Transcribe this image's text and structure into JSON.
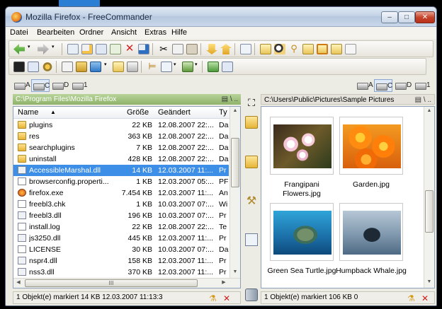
{
  "window": {
    "title": "Mozilla Firefox - FreeCommander",
    "min_label": "–",
    "max_label": "□",
    "close_label": "✕"
  },
  "menu": [
    "Datei",
    "Bearbeiten",
    "Ordner",
    "Ansicht",
    "Extras",
    "Hilfe"
  ],
  "drives": [
    "A",
    "C",
    "D",
    "1"
  ],
  "left_panel": {
    "path": "C:\\Program Files\\Mozilla Firefox",
    "path_tools": "▤ \\ ..",
    "columns": {
      "name": "Name",
      "sort_arrow": "▲",
      "size": "Größe",
      "date": "Geändert",
      "type": "Ty"
    },
    "rows": [
      {
        "icon": "folder",
        "name": "plugins",
        "size": "22 KB",
        "date": "12.08.2007 22:...",
        "type": "Da",
        "selected": false
      },
      {
        "icon": "folder",
        "name": "res",
        "size": "363 KB",
        "date": "12.08.2007 22:...",
        "type": "Da",
        "selected": false
      },
      {
        "icon": "folder",
        "name": "searchplugins",
        "size": "7 KB",
        "date": "12.08.2007 22:...",
        "type": "Da",
        "selected": false
      },
      {
        "icon": "folder",
        "name": "uninstall",
        "size": "428 KB",
        "date": "12.08.2007 22:...",
        "type": "Da",
        "selected": false
      },
      {
        "icon": "dll",
        "name": "AccessibleMarshal.dll",
        "size": "14 KB",
        "date": "12.03.2007 11:...",
        "type": "Pr",
        "selected": true
      },
      {
        "icon": "file",
        "name": "browserconfig.properti...",
        "size": "1 KB",
        "date": "12.03.2007 05:...",
        "type": "PF",
        "selected": false
      },
      {
        "icon": "exe",
        "name": "firefox.exe",
        "size": "7.454 KB",
        "date": "12.03.2007 11:...",
        "type": "An",
        "selected": false
      },
      {
        "icon": "file",
        "name": "freebl3.chk",
        "size": "1 KB",
        "date": "10.03.2007 07:...",
        "type": "Wi",
        "selected": false
      },
      {
        "icon": "dll",
        "name": "freebl3.dll",
        "size": "196 KB",
        "date": "10.03.2007 07:...",
        "type": "Pr",
        "selected": false
      },
      {
        "icon": "file",
        "name": "install.log",
        "size": "22 KB",
        "date": "12.08.2007 22:...",
        "type": "Te",
        "selected": false
      },
      {
        "icon": "dll",
        "name": "js3250.dll",
        "size": "445 KB",
        "date": "12.03.2007 11:...",
        "type": "Pr",
        "selected": false
      },
      {
        "icon": "file",
        "name": "LICENSE",
        "size": "30 KB",
        "date": "10.03.2007 07:...",
        "type": "Da",
        "selected": false
      },
      {
        "icon": "dll",
        "name": "nspr4.dll",
        "size": "158 KB",
        "date": "12.03.2007 11:...",
        "type": "Pr",
        "selected": false
      },
      {
        "icon": "dll",
        "name": "nss3.dll",
        "size": "370 KB",
        "date": "12.03.2007 11:...",
        "type": "Pr",
        "selected": false
      }
    ],
    "hscroll_grip": "III",
    "status": "1 Objekt(e) markiert   14 KB  12.03.2007 11:13:3"
  },
  "right_panel": {
    "path": "C:\\Users\\Public\\Pictures\\Sample Pictures",
    "path_tools": "▤ \\ ..",
    "thumbnails": [
      {
        "label": "Frangipani Flowers.jpg",
        "image": "frangipani"
      },
      {
        "label": "Garden.jpg",
        "image": "garden"
      },
      {
        "label": "Green Sea Turtle.jpg",
        "image": "turtle"
      },
      {
        "label": "Humpback Whale.jpg",
        "image": "whale"
      }
    ],
    "status": "1 Objekt(e) markiert   106 KB  0"
  },
  "colors": {
    "selection": "#3d8ee6",
    "active_path": "#8fb369"
  }
}
